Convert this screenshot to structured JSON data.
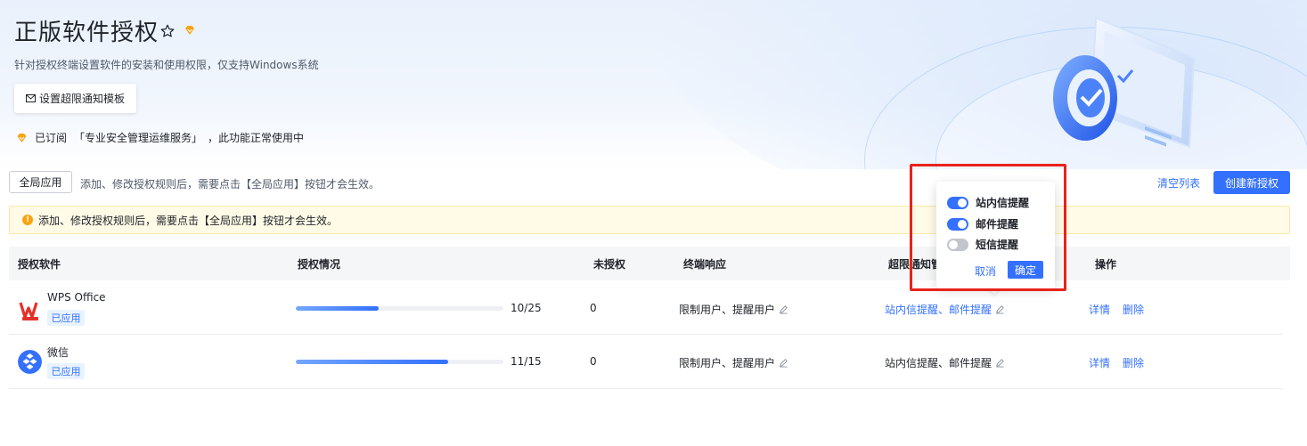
{
  "page": {
    "title": "正版软件授权",
    "subtitle": "针对授权终端设置软件的安装和使用权限，仅支持Windows系统",
    "template_button": "设置超限通知模板",
    "subscription": {
      "prefix": "已订阅",
      "service": "「专业安全管理运维服务」",
      "suffix": "，此功能正常使用中"
    }
  },
  "toolbar": {
    "global_apply": "全局应用",
    "hint": "添加、修改授权规则后，需要点击【全局应用】按钮才会生效。",
    "clear_list": "清空列表",
    "create": "创建新授权"
  },
  "alert": {
    "text": "添加、修改授权规则后，需要点击【全局应用】按钮才会生效。"
  },
  "table": {
    "headers": {
      "software": "授权软件",
      "status": "授权情况",
      "unauthorized": "未授权",
      "response": "终端响应",
      "notify": "超限通知管",
      "actions": "操作"
    },
    "rows": [
      {
        "name": "WPS Office",
        "tag": "已应用",
        "progress_text": "10/25",
        "progress": 0.4,
        "unauthorized": "0",
        "response": "限制用户、提醒用户",
        "notify": "站内信提醒、邮件提醒",
        "detail": "详情",
        "delete": "删除"
      },
      {
        "name": "微信",
        "tag": "已应用",
        "progress_text": "11/15",
        "progress": 0.733,
        "unauthorized": "0",
        "response": "限制用户、提醒用户",
        "notify": "站内信提醒、邮件提醒",
        "detail": "详情",
        "delete": "删除"
      }
    ]
  },
  "popover": {
    "options": [
      {
        "label": "站内信提醒",
        "on": true
      },
      {
        "label": "邮件提醒",
        "on": true
      },
      {
        "label": "短信提醒",
        "on": false
      }
    ],
    "cancel": "取消",
    "confirm": "确定"
  },
  "colors": {
    "primary": "#3370ff",
    "warning": "#f7a413",
    "highlight": "#e8231a"
  }
}
